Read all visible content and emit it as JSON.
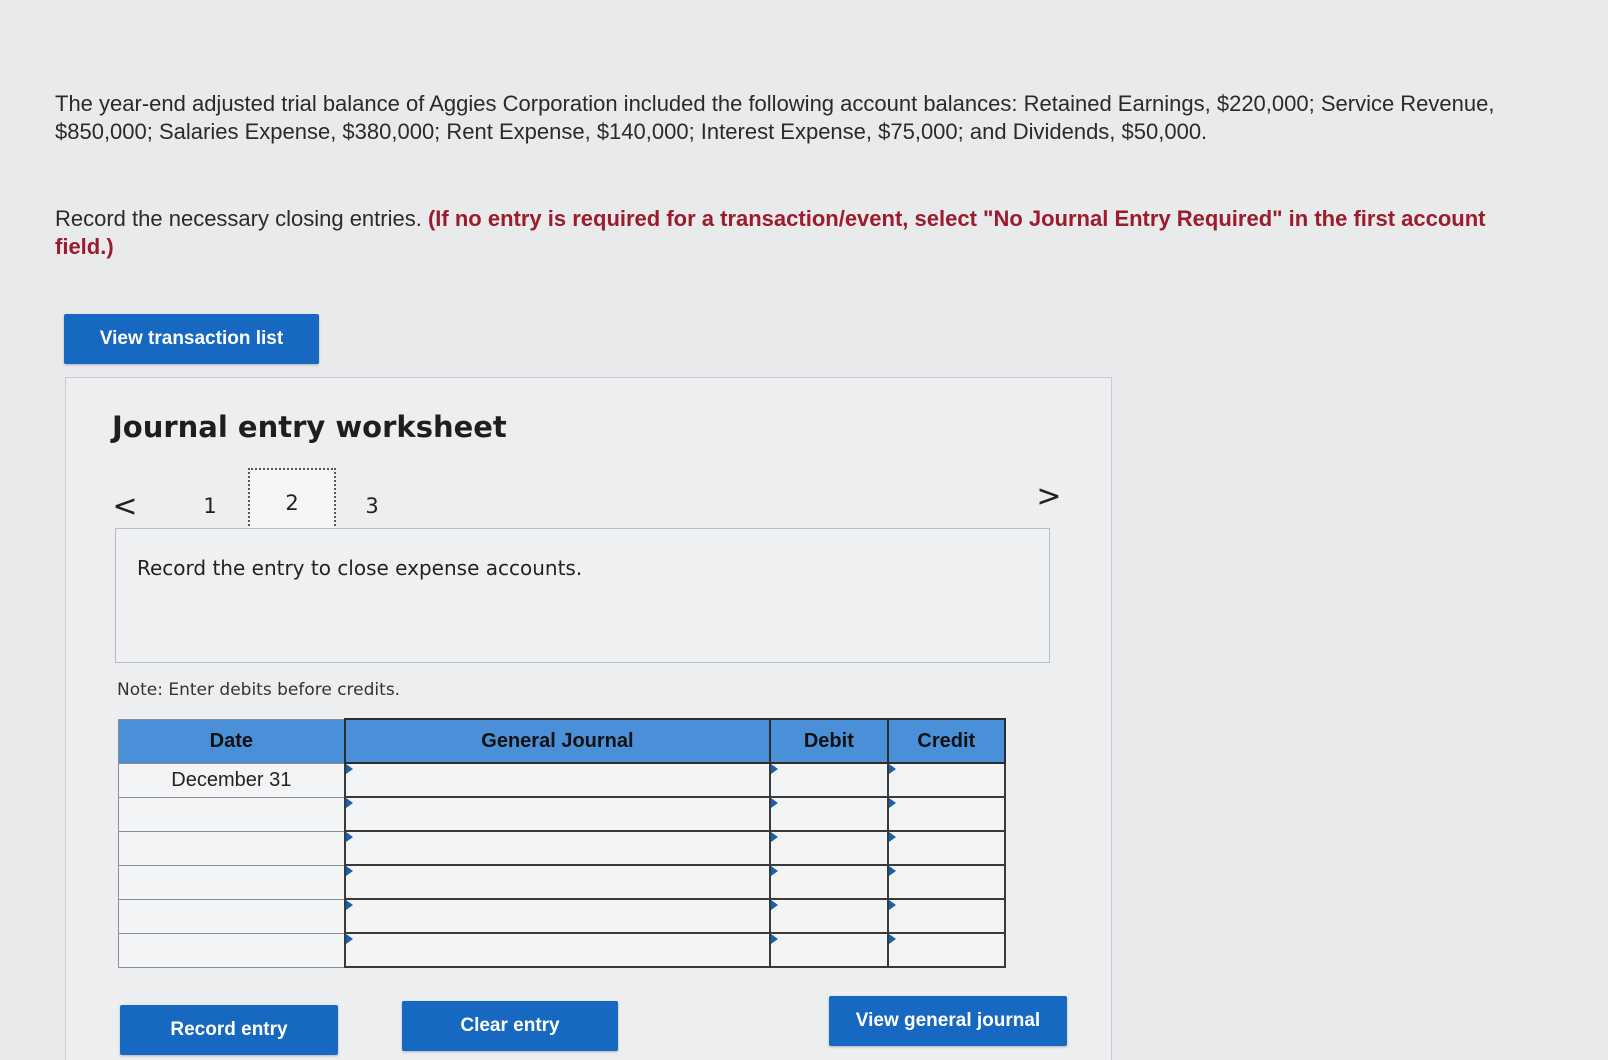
{
  "problem": {
    "intro": "The year-end adjusted trial balance of Aggies Corporation included the following account balances: Retained Earnings, $220,000; Service Revenue, $850,000; Salaries Expense, $380,000; Rent Expense, $140,000; Interest Expense, $75,000; and Dividends, $50,000.",
    "instruction_plain": "Record the necessary closing entries. ",
    "instruction_emphasis": "(If no entry is required for a transaction/event, select \"No Journal Entry Required\" in the first account field.)"
  },
  "buttons": {
    "view_transaction_list": "View transaction list",
    "record_entry": "Record entry",
    "clear_entry": "Clear entry",
    "view_general_journal": "View general journal"
  },
  "worksheet": {
    "title": "Journal entry worksheet",
    "nav": {
      "prev_icon": "chevron-left-icon",
      "next_icon": "chevron-right-icon",
      "prev_glyph": "<",
      "next_glyph": ">",
      "pages": [
        "1",
        "2",
        "3"
      ],
      "current": "2"
    },
    "description": "Record the entry to close expense accounts.",
    "note": "Note: Enter debits before credits."
  },
  "journal": {
    "headers": {
      "date": "Date",
      "general_journal": "General Journal",
      "debit": "Debit",
      "credit": "Credit"
    },
    "rows": [
      {
        "date": "December 31",
        "account": "",
        "debit": "",
        "credit": ""
      },
      {
        "date": "",
        "account": "",
        "debit": "",
        "credit": ""
      },
      {
        "date": "",
        "account": "",
        "debit": "",
        "credit": ""
      },
      {
        "date": "",
        "account": "",
        "debit": "",
        "credit": ""
      },
      {
        "date": "",
        "account": "",
        "debit": "",
        "credit": ""
      },
      {
        "date": "",
        "account": "",
        "debit": "",
        "credit": ""
      }
    ]
  },
  "colors": {
    "accent": "#1668c0",
    "header_blue": "#4a90d9",
    "emphasis_red": "#9b1c2c"
  }
}
